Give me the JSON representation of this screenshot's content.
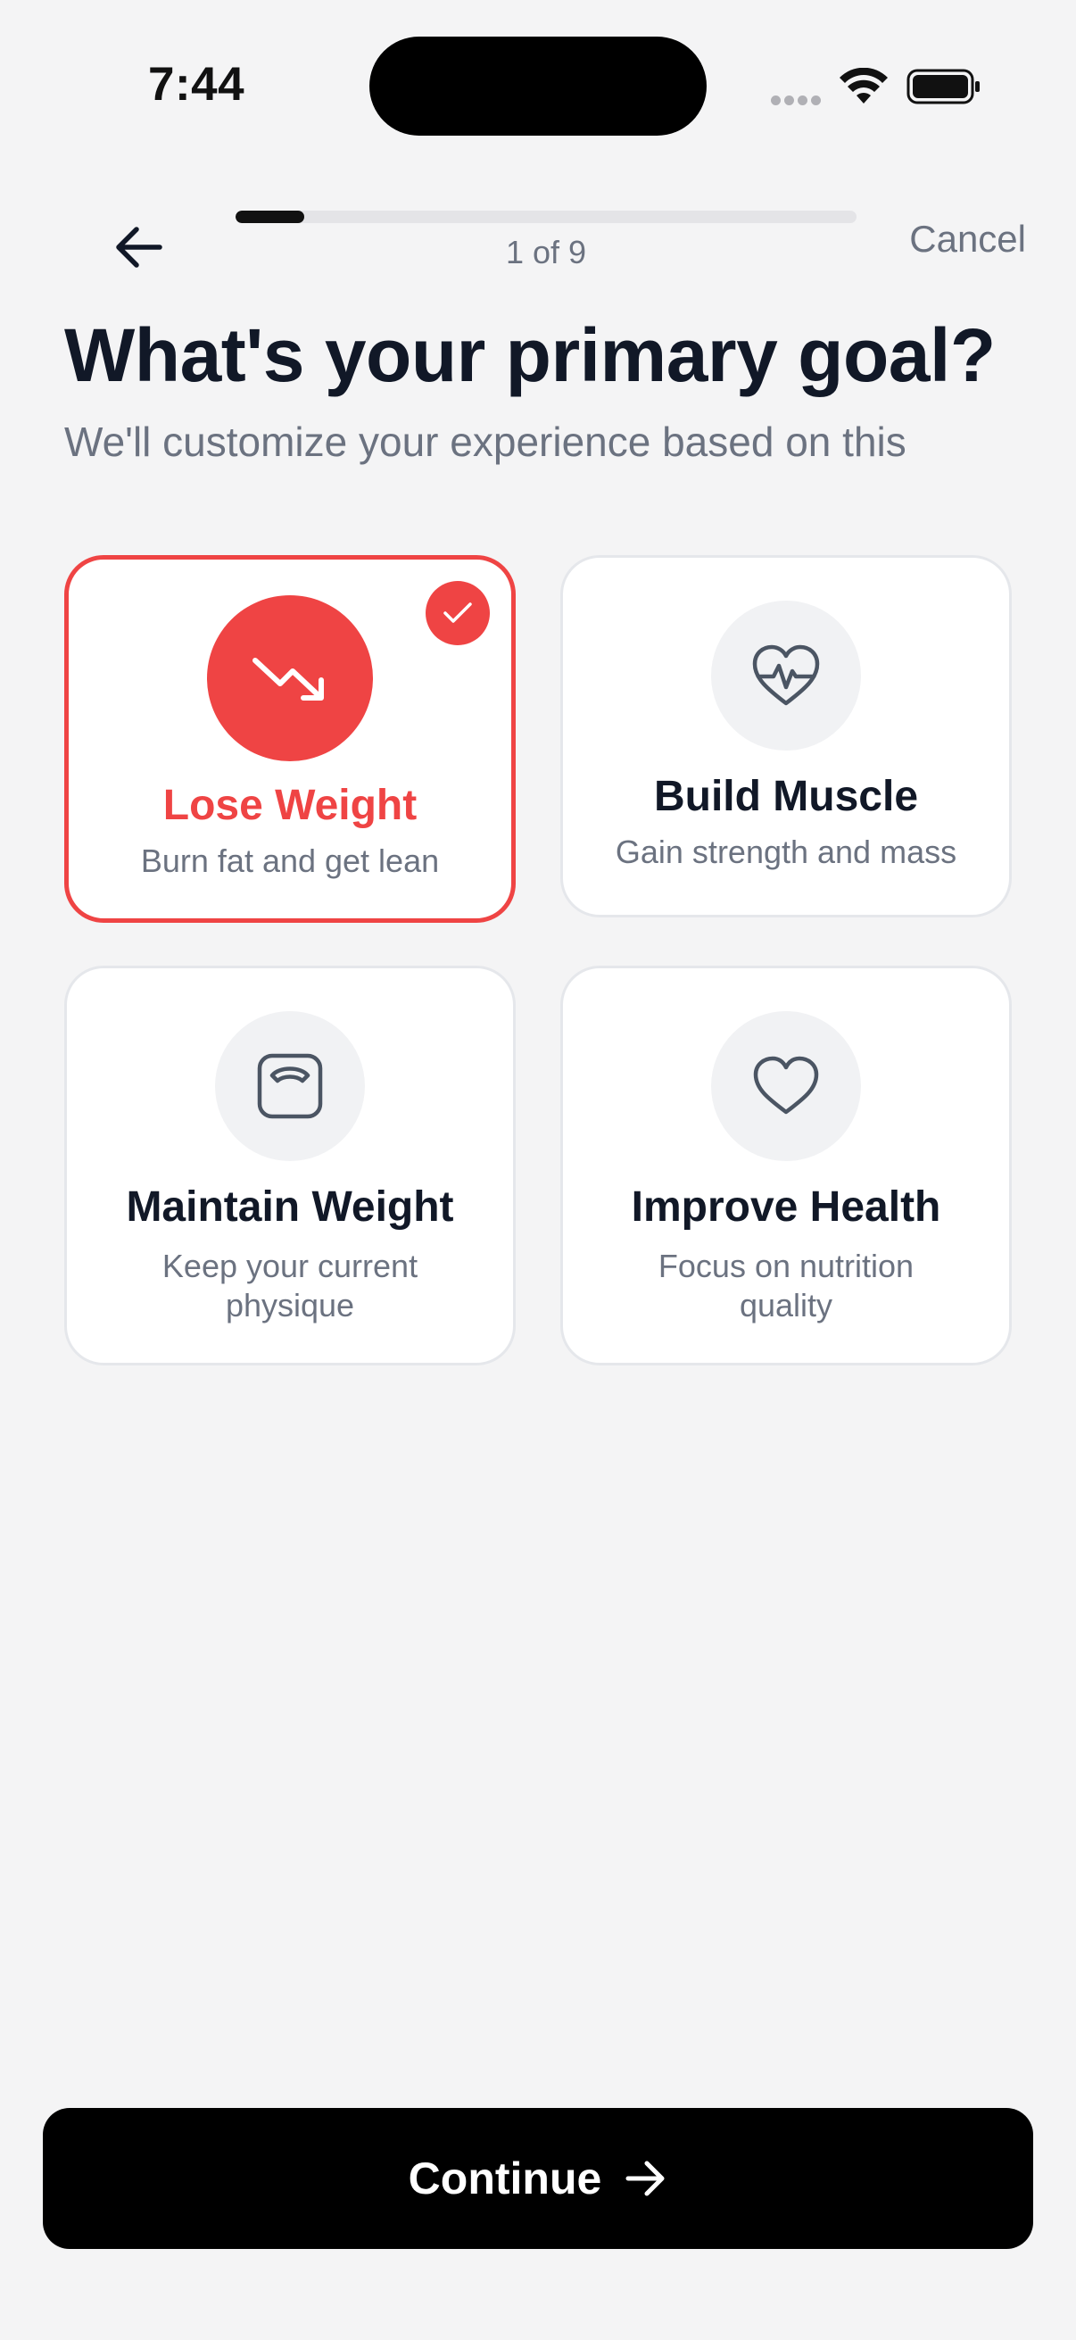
{
  "status_bar": {
    "time": "7:44"
  },
  "nav": {
    "progress_label": "1 of 9",
    "progress_fraction": 0.111,
    "cancel_label": "Cancel"
  },
  "header": {
    "title": "What's your primary goal?",
    "subtitle": "We'll customize your experience based on this"
  },
  "goals": [
    {
      "title": "Lose Weight",
      "description": "Burn fat and get lean",
      "icon": "trending-down-icon",
      "selected": true
    },
    {
      "title": "Build Muscle",
      "description": "Gain strength and mass",
      "icon": "heart-pulse-icon",
      "selected": false
    },
    {
      "title": "Maintain Weight",
      "description": "Keep your current physique",
      "icon": "scale-icon",
      "selected": false
    },
    {
      "title": "Improve Health",
      "description": "Focus on nutrition quality",
      "icon": "heart-icon",
      "selected": false
    }
  ],
  "footer": {
    "continue_label": "Continue"
  },
  "colors": {
    "accent": "#ef4444",
    "text_primary": "#111827",
    "text_secondary": "#6b7280",
    "background": "#f4f4f5"
  }
}
